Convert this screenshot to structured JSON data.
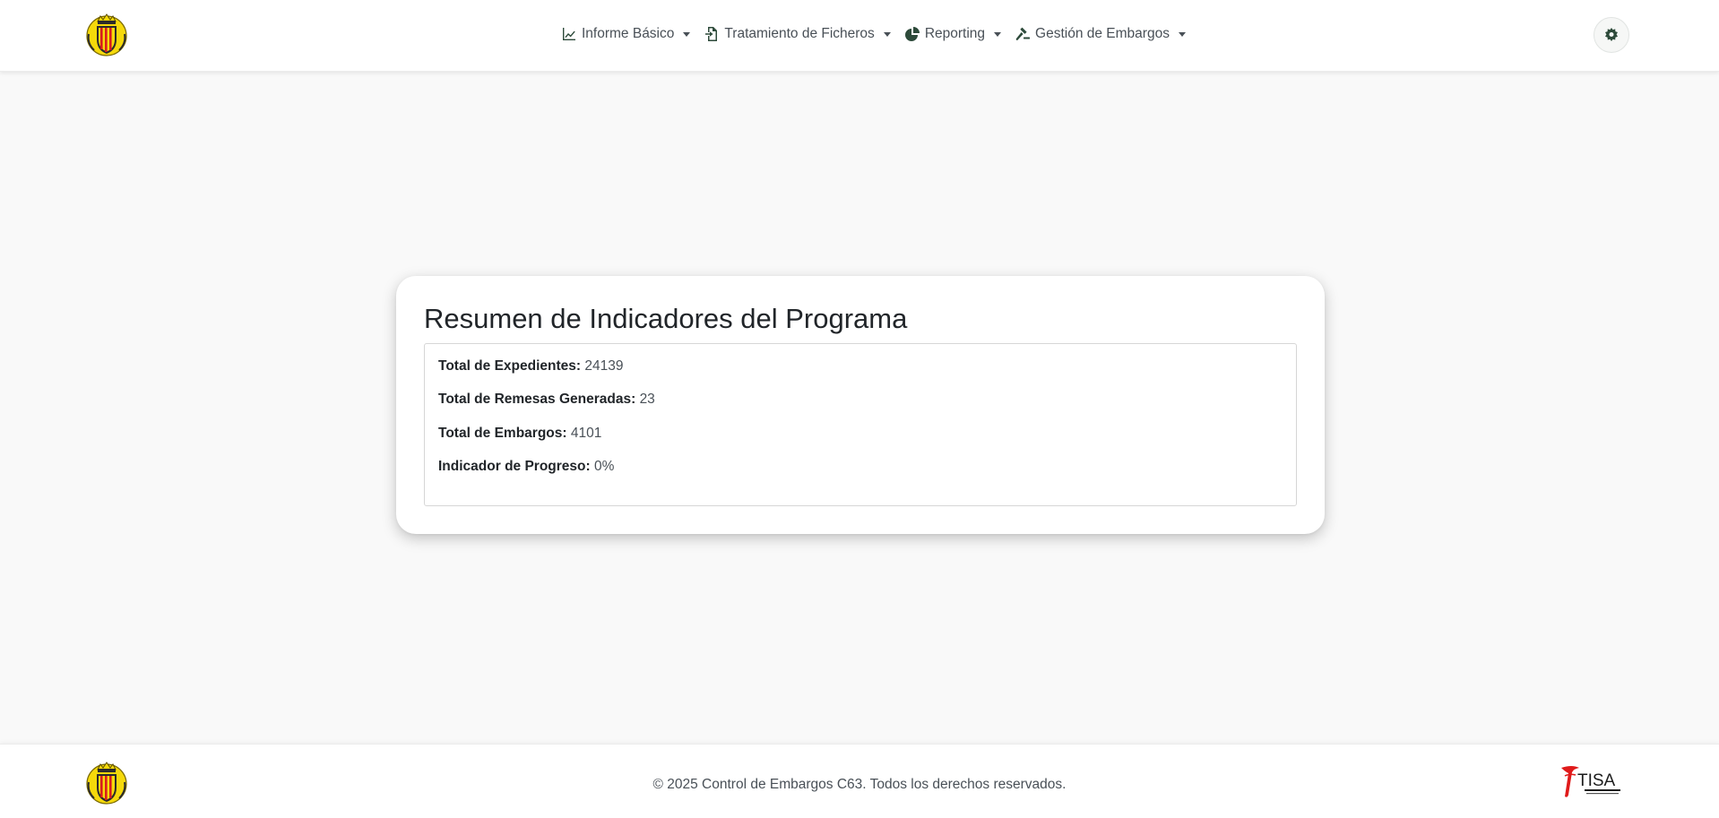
{
  "header": {
    "nav": [
      {
        "label": "Informe Básico",
        "icon": "line-chart-icon"
      },
      {
        "label": "Tratamiento de Ficheros",
        "icon": "file-import-icon"
      },
      {
        "label": "Reporting",
        "icon": "pie-chart-icon"
      },
      {
        "label": "Gestión de Embargos",
        "icon": "gavel-icon"
      }
    ],
    "theme_toggle_icon": "gear-icon"
  },
  "main": {
    "title": "Resumen de Indicadores del Programa",
    "stats": [
      {
        "label": "Total de Expedientes:",
        "value": "24139"
      },
      {
        "label": "Total de Remesas Generadas:",
        "value": "23"
      },
      {
        "label": "Total de Embargos:",
        "value": "4101"
      },
      {
        "label": "Indicador de Progreso:",
        "value": "0%"
      }
    ]
  },
  "footer": {
    "copyright": "© 2025 Control de Embargos C63. Todos los derechos reservados.",
    "partner_logo_text": "TISA"
  },
  "colors": {
    "page_background": "#f9f9f9",
    "icon_green": "#2d4a3a",
    "crest_yellow": "#f5d90a",
    "crest_red": "#d81e1e",
    "partner_red": "#e01b1b"
  }
}
